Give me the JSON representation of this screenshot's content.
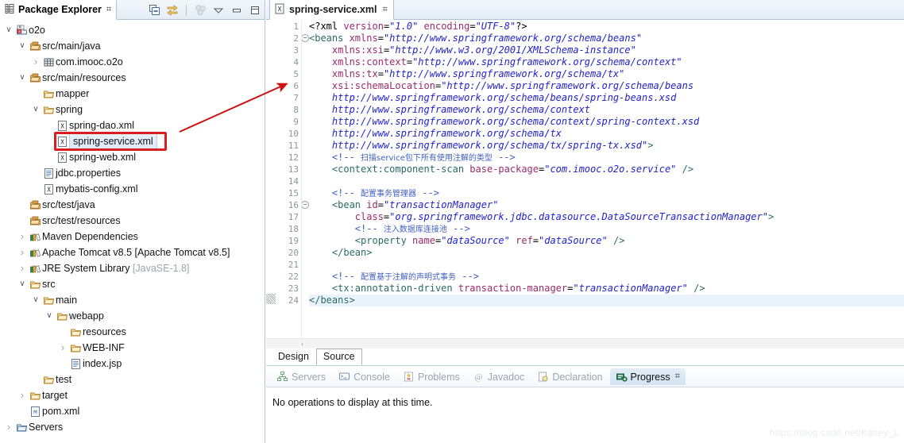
{
  "explorer": {
    "tab_label": "Package Explorer",
    "tab_icon": "package-explorer-icon",
    "close_glyph": "⌗",
    "toolbar": [
      {
        "name": "collapse-all-icon",
        "title": "Collapse All"
      },
      {
        "name": "link-with-editor-icon",
        "title": "Link with Editor"
      },
      {
        "name": "focus-on-active-task-icon",
        "title": "Focus on Active Task"
      },
      {
        "name": "view-menu-icon",
        "title": "View Menu"
      },
      {
        "name": "minimize-icon",
        "title": "Minimize"
      },
      {
        "name": "maximize-icon",
        "title": "Maximize"
      }
    ],
    "tree": [
      {
        "indent": 0,
        "twisty": "v",
        "icon": "maven-project-icon",
        "label": "o2o"
      },
      {
        "indent": 1,
        "twisty": "v",
        "icon": "source-folder-icon",
        "label": "src/main/java"
      },
      {
        "indent": 2,
        "twisty": ">",
        "icon": "package-icon",
        "label": "com.imooc.o2o"
      },
      {
        "indent": 1,
        "twisty": "v",
        "icon": "source-folder-icon",
        "label": "src/main/resources"
      },
      {
        "indent": 2,
        "twisty": "",
        "icon": "folder-icon",
        "label": "mapper"
      },
      {
        "indent": 2,
        "twisty": "v",
        "icon": "folder-icon",
        "label": "spring"
      },
      {
        "indent": 3,
        "twisty": "",
        "icon": "xml-file-icon",
        "label": "spring-dao.xml"
      },
      {
        "indent": 3,
        "twisty": "",
        "icon": "xml-file-icon",
        "label": "spring-service.xml",
        "selected": true
      },
      {
        "indent": 3,
        "twisty": "",
        "icon": "xml-file-icon",
        "label": "spring-web.xml"
      },
      {
        "indent": 2,
        "twisty": "",
        "icon": "properties-file-icon",
        "label": "jdbc.properties"
      },
      {
        "indent": 2,
        "twisty": "",
        "icon": "xml-file-icon",
        "label": "mybatis-config.xml"
      },
      {
        "indent": 1,
        "twisty": "",
        "icon": "source-folder-icon",
        "label": "src/test/java"
      },
      {
        "indent": 1,
        "twisty": "",
        "icon": "source-folder-icon",
        "label": "src/test/resources"
      },
      {
        "indent": 1,
        "twisty": ">",
        "icon": "library-icon",
        "label": "Maven Dependencies"
      },
      {
        "indent": 1,
        "twisty": ">",
        "icon": "library-icon",
        "label": "Apache Tomcat v8.5 [Apache Tomcat v8.5]"
      },
      {
        "indent": 1,
        "twisty": ">",
        "icon": "library-icon",
        "label": "JRE System Library ",
        "dim": "[JavaSE-1.8]"
      },
      {
        "indent": 1,
        "twisty": "v",
        "icon": "folder-icon",
        "label": "src"
      },
      {
        "indent": 2,
        "twisty": "v",
        "icon": "folder-icon",
        "label": "main"
      },
      {
        "indent": 3,
        "twisty": "v",
        "icon": "folder-icon",
        "label": "webapp"
      },
      {
        "indent": 4,
        "twisty": "",
        "icon": "folder-icon",
        "label": "resources"
      },
      {
        "indent": 4,
        "twisty": ">",
        "icon": "folder-icon",
        "label": "WEB-INF"
      },
      {
        "indent": 4,
        "twisty": "",
        "icon": "jsp-file-icon",
        "label": "index.jsp"
      },
      {
        "indent": 2,
        "twisty": "",
        "icon": "folder-icon",
        "label": "test"
      },
      {
        "indent": 1,
        "twisty": ">",
        "icon": "folder-icon",
        "label": "target"
      },
      {
        "indent": 1,
        "twisty": "",
        "icon": "maven-pom-icon",
        "label": "pom.xml"
      },
      {
        "indent": 0,
        "twisty": ">",
        "icon": "servers-folder-icon",
        "label": "Servers"
      }
    ]
  },
  "editor": {
    "tab_label": "spring-service.xml",
    "tab_icon": "xml-file-icon",
    "close_glyph": "⌗",
    "design_tabs": [
      {
        "label": "Design",
        "active": false
      },
      {
        "label": "Source",
        "active": true
      }
    ],
    "scroll_left_glyph": "‹",
    "lines": [
      {
        "n": "1",
        "fold": false,
        "current": false,
        "tokens": [
          {
            "t": "plain",
            "s": "<?xml "
          },
          {
            "t": "attr",
            "s": "version"
          },
          {
            "t": "plain",
            "s": "="
          },
          {
            "t": "val",
            "s": "\"1.0\""
          },
          {
            "t": "plain",
            "s": " "
          },
          {
            "t": "attr",
            "s": "encoding"
          },
          {
            "t": "plain",
            "s": "="
          },
          {
            "t": "val",
            "s": "\"UTF-8\""
          },
          {
            "t": "plain",
            "s": "?>"
          }
        ]
      },
      {
        "n": "2",
        "fold": true,
        "current": false,
        "tokens": [
          {
            "t": "tag",
            "s": "<beans "
          },
          {
            "t": "attr",
            "s": "xmlns"
          },
          {
            "t": "plain",
            "s": "="
          },
          {
            "t": "val",
            "s": "\"http://www.springframework.org/schema/beans\""
          }
        ]
      },
      {
        "n": "3",
        "fold": false,
        "current": false,
        "tokens": [
          {
            "t": "plain",
            "s": "    "
          },
          {
            "t": "attr",
            "s": "xmlns:xsi"
          },
          {
            "t": "plain",
            "s": "="
          },
          {
            "t": "val",
            "s": "\"http://www.w3.org/2001/XMLSchema-instance\""
          }
        ]
      },
      {
        "n": "4",
        "fold": false,
        "current": false,
        "tokens": [
          {
            "t": "plain",
            "s": "    "
          },
          {
            "t": "attr",
            "s": "xmlns:context"
          },
          {
            "t": "plain",
            "s": "="
          },
          {
            "t": "val",
            "s": "\"http://www.springframework.org/schema/context\""
          }
        ]
      },
      {
        "n": "5",
        "fold": false,
        "current": false,
        "tokens": [
          {
            "t": "plain",
            "s": "    "
          },
          {
            "t": "attr",
            "s": "xmlns:tx"
          },
          {
            "t": "plain",
            "s": "="
          },
          {
            "t": "val",
            "s": "\"http://www.springframework.org/schema/tx\""
          }
        ]
      },
      {
        "n": "6",
        "fold": false,
        "current": false,
        "tokens": [
          {
            "t": "plain",
            "s": "    "
          },
          {
            "t": "attr",
            "s": "xsi:schemaLocation"
          },
          {
            "t": "plain",
            "s": "="
          },
          {
            "t": "val",
            "s": "\"http://www.springframework.org/schema/beans"
          }
        ]
      },
      {
        "n": "7",
        "fold": false,
        "current": false,
        "tokens": [
          {
            "t": "plain",
            "s": "    "
          },
          {
            "t": "val",
            "s": "http://www.springframework.org/schema/beans/spring-beans.xsd"
          }
        ]
      },
      {
        "n": "8",
        "fold": false,
        "current": false,
        "tokens": [
          {
            "t": "plain",
            "s": "    "
          },
          {
            "t": "val",
            "s": "http://www.springframework.org/schema/context"
          }
        ]
      },
      {
        "n": "9",
        "fold": false,
        "current": false,
        "tokens": [
          {
            "t": "plain",
            "s": "    "
          },
          {
            "t": "val",
            "s": "http://www.springframework.org/schema/context/spring-context.xsd"
          }
        ]
      },
      {
        "n": "10",
        "fold": false,
        "current": false,
        "tokens": [
          {
            "t": "plain",
            "s": "    "
          },
          {
            "t": "val",
            "s": "http://www.springframework.org/schema/tx"
          }
        ]
      },
      {
        "n": "11",
        "fold": false,
        "current": false,
        "tokens": [
          {
            "t": "plain",
            "s": "    "
          },
          {
            "t": "val",
            "s": "http://www.springframework.org/schema/tx/spring-tx.xsd\""
          },
          {
            "t": "tag",
            "s": ">"
          }
        ]
      },
      {
        "n": "12",
        "fold": false,
        "current": false,
        "tokens": [
          {
            "t": "plain",
            "s": "    "
          },
          {
            "t": "cmt",
            "s": "<!-- "
          },
          {
            "t": "cmtcn",
            "s": "扫描service包下所有使用注解的类型"
          },
          {
            "t": "cmt",
            "s": " -->"
          }
        ]
      },
      {
        "n": "13",
        "fold": false,
        "current": false,
        "tokens": [
          {
            "t": "plain",
            "s": "    "
          },
          {
            "t": "tag",
            "s": "<context:component-scan "
          },
          {
            "t": "attr",
            "s": "base-package"
          },
          {
            "t": "plain",
            "s": "="
          },
          {
            "t": "val",
            "s": "\"com.imooc.o2o.service\""
          },
          {
            "t": "tag",
            "s": " />"
          }
        ]
      },
      {
        "n": "14",
        "fold": false,
        "current": false,
        "tokens": []
      },
      {
        "n": "15",
        "fold": false,
        "current": false,
        "tokens": [
          {
            "t": "plain",
            "s": "    "
          },
          {
            "t": "cmt",
            "s": "<!-- "
          },
          {
            "t": "cmtcn",
            "s": "配置事务管理器"
          },
          {
            "t": "cmt",
            "s": " -->"
          }
        ]
      },
      {
        "n": "16",
        "fold": true,
        "current": false,
        "tokens": [
          {
            "t": "plain",
            "s": "    "
          },
          {
            "t": "tag",
            "s": "<bean "
          },
          {
            "t": "attr",
            "s": "id"
          },
          {
            "t": "plain",
            "s": "="
          },
          {
            "t": "val",
            "s": "\"transactionManager\""
          }
        ]
      },
      {
        "n": "17",
        "fold": false,
        "current": false,
        "tokens": [
          {
            "t": "plain",
            "s": "        "
          },
          {
            "t": "attr",
            "s": "class"
          },
          {
            "t": "plain",
            "s": "="
          },
          {
            "t": "val",
            "s": "\"org.springframework.jdbc.datasource.DataSourceTransactionManager\""
          },
          {
            "t": "tag",
            "s": ">"
          }
        ]
      },
      {
        "n": "18",
        "fold": false,
        "current": false,
        "tokens": [
          {
            "t": "plain",
            "s": "        "
          },
          {
            "t": "cmt",
            "s": "<!-- "
          },
          {
            "t": "cmtcn",
            "s": "注入数据库连接池"
          },
          {
            "t": "cmt",
            "s": " -->"
          }
        ]
      },
      {
        "n": "19",
        "fold": false,
        "current": false,
        "tokens": [
          {
            "t": "plain",
            "s": "        "
          },
          {
            "t": "tag",
            "s": "<property "
          },
          {
            "t": "attr",
            "s": "name"
          },
          {
            "t": "plain",
            "s": "="
          },
          {
            "t": "val",
            "s": "\"dataSource\""
          },
          {
            "t": "plain",
            "s": " "
          },
          {
            "t": "attr",
            "s": "ref"
          },
          {
            "t": "plain",
            "s": "="
          },
          {
            "t": "val",
            "s": "\"dataSource\""
          },
          {
            "t": "tag",
            "s": " />"
          }
        ]
      },
      {
        "n": "20",
        "fold": false,
        "current": false,
        "tokens": [
          {
            "t": "plain",
            "s": "    "
          },
          {
            "t": "tag",
            "s": "</bean>"
          }
        ]
      },
      {
        "n": "21",
        "fold": false,
        "current": false,
        "tokens": []
      },
      {
        "n": "22",
        "fold": false,
        "current": false,
        "tokens": [
          {
            "t": "plain",
            "s": "    "
          },
          {
            "t": "cmt",
            "s": "<!-- "
          },
          {
            "t": "cmtcn",
            "s": "配置基于注解的声明式事务"
          },
          {
            "t": "cmt",
            "s": " -->"
          }
        ]
      },
      {
        "n": "23",
        "fold": false,
        "current": false,
        "tokens": [
          {
            "t": "plain",
            "s": "    "
          },
          {
            "t": "tag",
            "s": "<tx:annotation-driven "
          },
          {
            "t": "attr",
            "s": "transaction-manager"
          },
          {
            "t": "plain",
            "s": "="
          },
          {
            "t": "val",
            "s": "\"transactionManager\""
          },
          {
            "t": "tag",
            "s": " />"
          }
        ]
      },
      {
        "n": "24",
        "fold": false,
        "current": true,
        "tokens": [
          {
            "t": "tag",
            "s": "</beans>"
          }
        ]
      }
    ]
  },
  "bottom": {
    "tabs": [
      {
        "label": "Servers",
        "icon": "servers-icon",
        "active": false
      },
      {
        "label": "Console",
        "icon": "console-icon",
        "active": false
      },
      {
        "label": "Problems",
        "icon": "problems-icon",
        "active": false
      },
      {
        "label": "Javadoc",
        "icon": "javadoc-icon",
        "active": false
      },
      {
        "label": "Declaration",
        "icon": "declaration-icon",
        "active": false
      },
      {
        "label": "Progress",
        "icon": "progress-icon",
        "active": true
      }
    ],
    "close_glyph": "⌗",
    "message": "No operations to display at this time."
  },
  "annotation": {
    "highlight_color": "#d81f1f",
    "arrow_color": "#cc1111"
  },
  "watermark": "https://blog.csdn.net/Kasey_L"
}
